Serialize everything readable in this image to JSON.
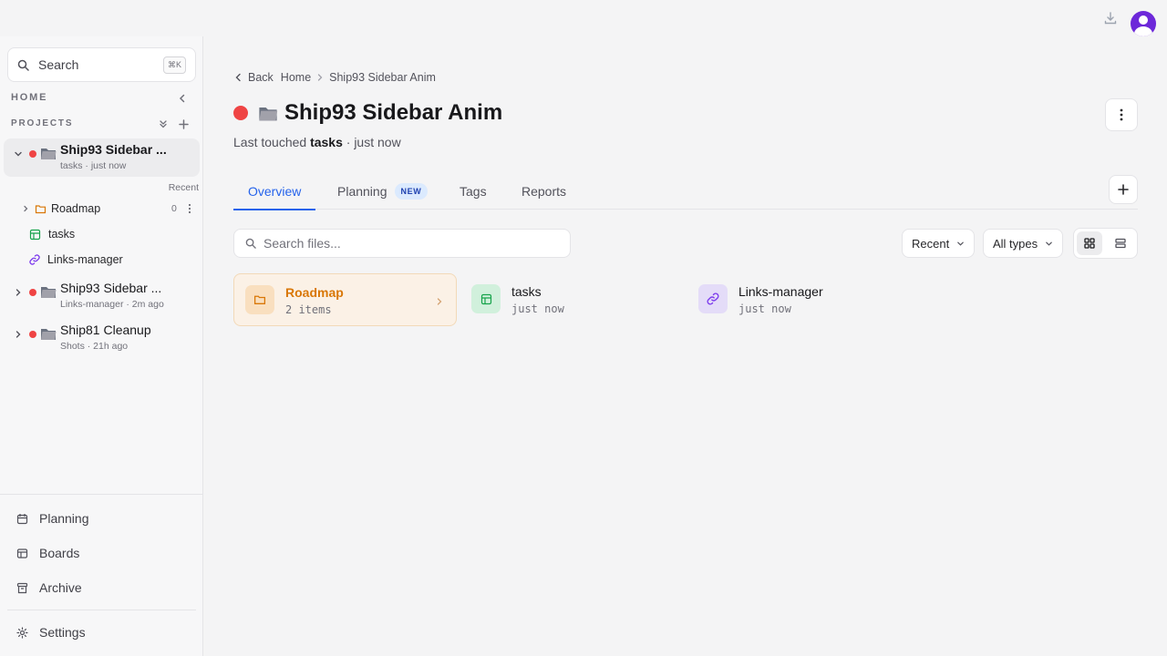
{
  "sidebar": {
    "search_label": "Search",
    "search_shortcut": "⌘K",
    "home_label": "HOME",
    "projects_label": "PROJECTS",
    "projects": [
      {
        "name": "Ship93 Sidebar ...",
        "meta": "tasks · just now",
        "expanded": true,
        "status_color": "#ef4444"
      },
      {
        "name": "Ship93 Sidebar ...",
        "meta": "Links-manager · 2m ago",
        "expanded": false,
        "status_color": "#ef4444"
      },
      {
        "name": "Ship81 Cleanup",
        "meta": "Shots · 21h ago",
        "expanded": false,
        "status_color": "#ef4444"
      }
    ],
    "recent_label": "Recent",
    "children": [
      {
        "name": "Roadmap",
        "count": "0",
        "icon": "folder-icon"
      },
      {
        "name": "tasks",
        "icon": "table-icon"
      },
      {
        "name": "Links-manager",
        "icon": "link-icon"
      }
    ],
    "bottom_nav": [
      {
        "label": "Planning",
        "icon": "calendar-icon"
      },
      {
        "label": "Boards",
        "icon": "board-icon"
      },
      {
        "label": "Archive",
        "icon": "archive-icon"
      }
    ],
    "settings_label": "Settings"
  },
  "breadcrumb": {
    "back": "Back",
    "home": "Home",
    "current": "Ship93 Sidebar Anim"
  },
  "header": {
    "title": "Ship93 Sidebar Anim",
    "subtitle_prefix": "Last touched",
    "subtitle_item": "tasks",
    "subtitle_suffix": "· just now"
  },
  "tabs": [
    {
      "label": "Overview",
      "active": true
    },
    {
      "label": "Planning",
      "badge": "NEW"
    },
    {
      "label": "Tags"
    },
    {
      "label": "Reports"
    }
  ],
  "toolbar": {
    "search_placeholder": "Search files...",
    "sort_value": "Recent",
    "type_value": "All types",
    "view_mode": "grid"
  },
  "files": [
    {
      "name": "Roadmap",
      "meta": "2 items",
      "type": "folder"
    },
    {
      "name": "tasks",
      "meta": "just now",
      "type": "table"
    },
    {
      "name": "Links-manager",
      "meta": "just now",
      "type": "link"
    }
  ],
  "colors": {
    "accent": "#2563eb",
    "status_red": "#ef4444",
    "folder_orange": "#d97706",
    "table_green": "#16a34a",
    "link_purple": "#7c3aed",
    "avatar": "#6d28d9"
  }
}
